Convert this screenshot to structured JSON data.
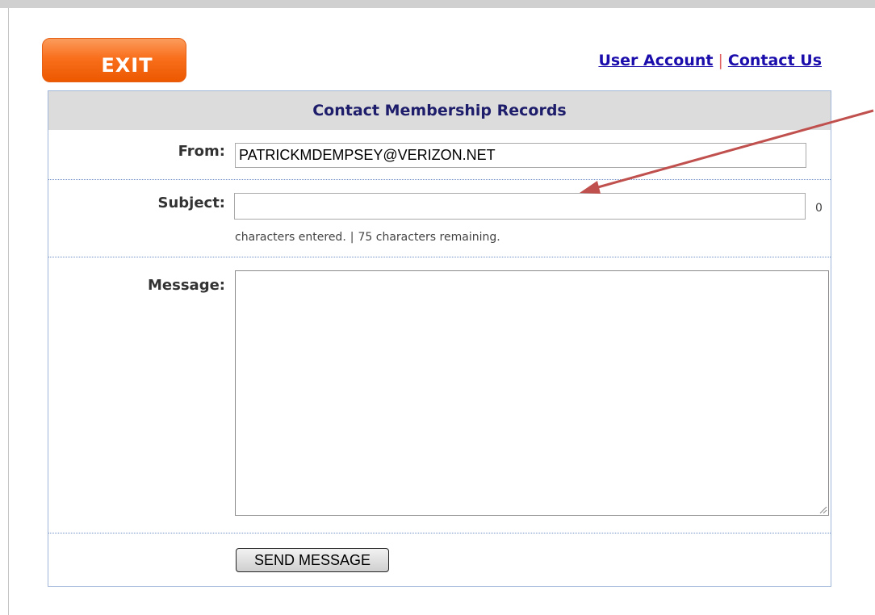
{
  "header": {
    "exit_label": "EXIT",
    "links": {
      "user_account": "User Account",
      "separator": "|",
      "contact_us": "Contact Us"
    }
  },
  "form": {
    "title": "Contact Membership Records",
    "from": {
      "label": "From:",
      "value": "PATRICKMDEMPSEY@VERIZON.NET"
    },
    "subject": {
      "label": "Subject:",
      "value": "",
      "count": "0",
      "entered_text": "characters entered.",
      "separator": "|",
      "remaining_text": "75 characters remaining."
    },
    "message": {
      "label": "Message:",
      "value": ""
    },
    "send_label": "SEND MESSAGE"
  },
  "annotation": {
    "arrow_color": "#c0504d",
    "icon": "annotation-arrow-icon"
  },
  "colors": {
    "exit_button": "#f96f1c",
    "link": "#1a0dab",
    "panel_header_bg": "#dcdcdc",
    "panel_title": "#1d1d6b",
    "panel_border": "#9fb6d9"
  }
}
